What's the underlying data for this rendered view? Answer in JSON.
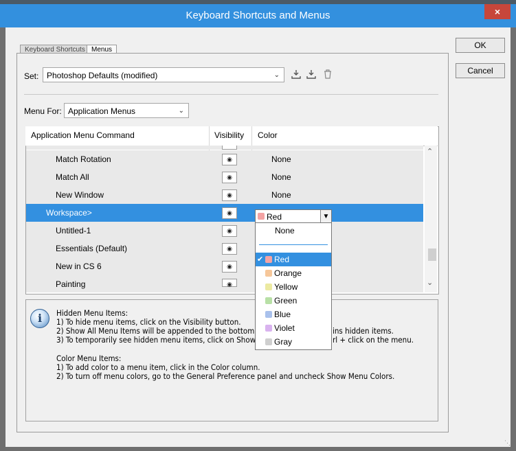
{
  "window": {
    "title": "Keyboard Shortcuts and Menus",
    "close_glyph": "×"
  },
  "tabs": [
    {
      "label": "Keyboard Shortcuts"
    },
    {
      "label": "Menus"
    }
  ],
  "buttons": {
    "ok": "OK",
    "cancel": "Cancel"
  },
  "set": {
    "label": "Set:",
    "value": "Photoshop Defaults (modified)"
  },
  "menu_for": {
    "label": "Menu For:",
    "value": "Application Menus"
  },
  "table": {
    "headers": {
      "command": "Application Menu Command",
      "visibility": "Visibility",
      "color": "Color"
    },
    "rows": [
      {
        "command": "Match Rotation",
        "color": "None",
        "indent": 2,
        "selected": false
      },
      {
        "command": "Match All",
        "color": "None",
        "indent": 2,
        "selected": false
      },
      {
        "command": "New Window",
        "color": "None",
        "indent": 2,
        "selected": false
      },
      {
        "command": "Workspace>",
        "color": "Red",
        "indent": 1,
        "selected": true
      },
      {
        "command": "Untitled-1",
        "color": "",
        "indent": 2,
        "selected": false
      },
      {
        "command": "Essentials (Default)",
        "color": "",
        "indent": 2,
        "selected": false
      },
      {
        "command": "New in CS 6",
        "color": "",
        "indent": 2,
        "selected": false
      },
      {
        "command": "Painting",
        "color": "",
        "indent": 2,
        "selected": false
      }
    ]
  },
  "color_dropdown": {
    "selected": "Red",
    "options": [
      {
        "label": "None",
        "swatch": ""
      },
      {
        "label": "Red",
        "swatch": "#f4a3a3",
        "checked": true
      },
      {
        "label": "Orange",
        "swatch": "#f6c79a"
      },
      {
        "label": "Yellow",
        "swatch": "#eceaa2"
      },
      {
        "label": "Green",
        "swatch": "#b8e0a6"
      },
      {
        "label": "Blue",
        "swatch": "#a9c1ec"
      },
      {
        "label": "Violet",
        "swatch": "#d9b3ef"
      },
      {
        "label": "Gray",
        "swatch": "#cfcfcf"
      }
    ]
  },
  "info": {
    "lines": [
      "Hidden Menu Items:",
      "1) To hide menu items, click on the Visibility button.",
      "2) Show All Menu Items will be appended to the bottom",
      "3) To temporarily see hidden menu items, click on Show",
      "",
      "Color Menu Items:",
      "1) To add color to a menu item, click in the Color column.",
      "2) To turn off menu colors, go to the General Preference panel and uncheck Show Menu Colors."
    ],
    "suffix_2": "ins hidden items.",
    "suffix_3": "rl + click on the menu."
  },
  "icons": {
    "eye": "eye-icon",
    "save": "save-set-icon",
    "save_as": "save-set-as-icon",
    "delete": "delete-set-icon",
    "info": "info-icon",
    "check": "checkmark-icon"
  }
}
